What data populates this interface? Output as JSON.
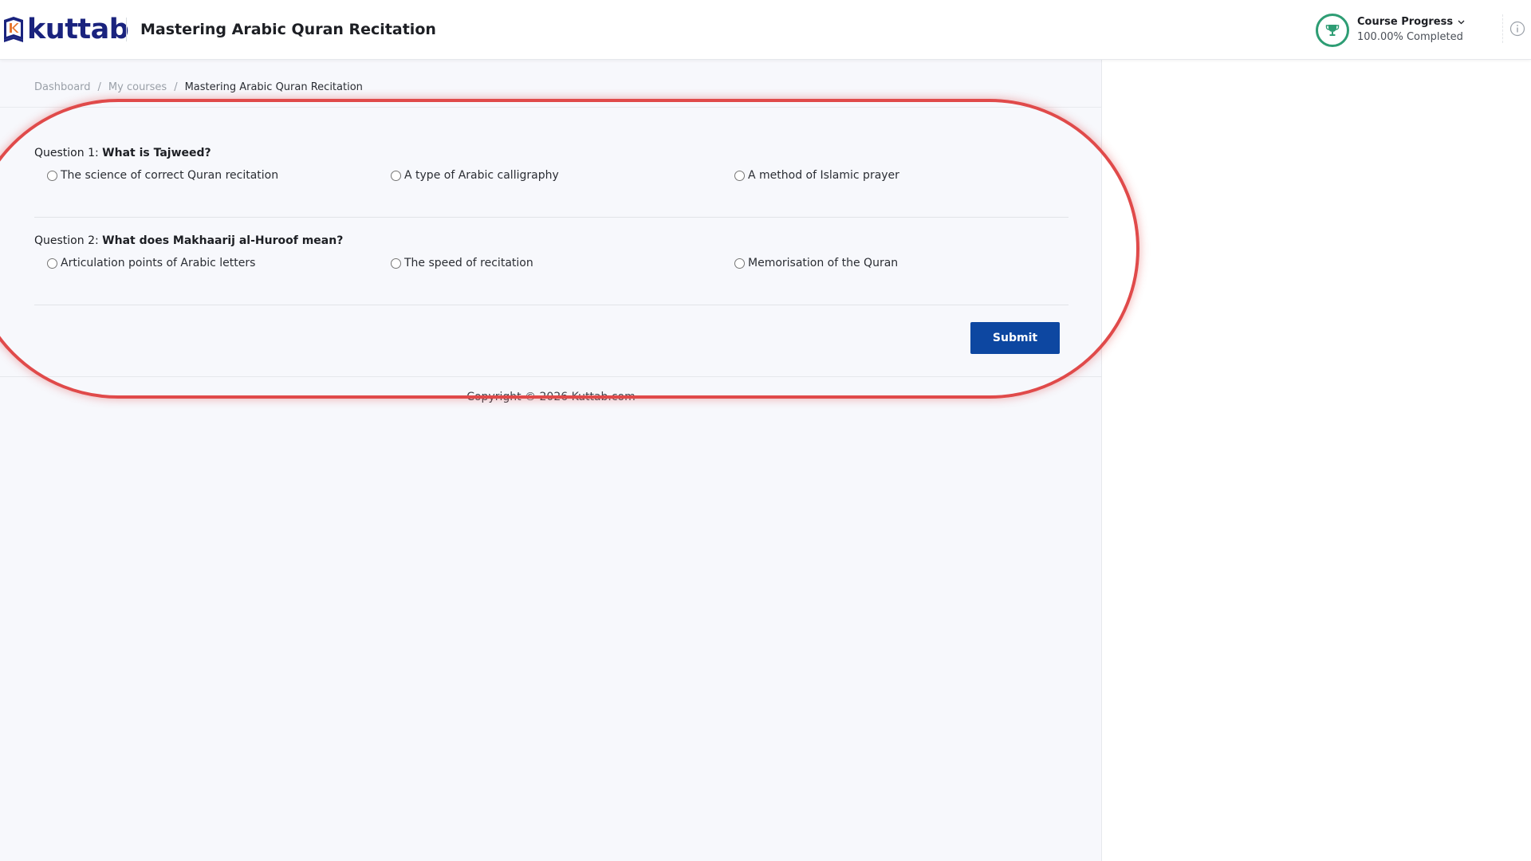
{
  "header": {
    "logo_text": "kuttab",
    "course_title": "Mastering Arabic Quran Recitation",
    "progress_label": "Course Progress",
    "progress_value": "100.00% Completed",
    "progress_fraction": 1.0
  },
  "breadcrumb": {
    "items": [
      "Dashboard",
      "My courses"
    ],
    "current": "Mastering Arabic Quran Recitation",
    "separator": "/"
  },
  "quiz": {
    "questions": [
      {
        "prefix": "Question 1:",
        "text": "What is Tajweed?",
        "options": [
          "The science of correct Quran recitation",
          "A type of Arabic calligraphy",
          "A method of Islamic prayer"
        ]
      },
      {
        "prefix": "Question 2:",
        "text": "What does Makhaarij al-Huroof mean?",
        "options": [
          "Articulation points of Arabic letters",
          "The speed of recitation",
          "Memorisation of the Quran"
        ]
      }
    ],
    "submit_label": "Submit"
  },
  "footer": {
    "copyright": "Copyright © 2026 Kuttab.com"
  },
  "colors": {
    "brand": "#1a237e",
    "primary": "#0d47a1",
    "progress": "#2e9d74",
    "highlight": "#e04a4a"
  },
  "icons": {
    "progress": "trophy-icon",
    "dropdown": "chevron-down-icon",
    "info": "info-icon",
    "logo": "book-k-icon"
  }
}
